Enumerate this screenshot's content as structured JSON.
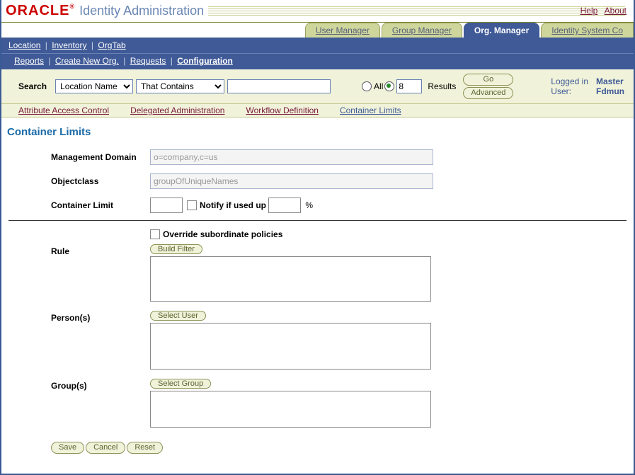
{
  "brand": {
    "name": "ORACLE",
    "product": "Identity Administration"
  },
  "top_links": {
    "help": "Help",
    "about": "About"
  },
  "tabs": {
    "user": "User Manager",
    "group": "Group Manager",
    "org": "Org. Manager",
    "sysconfig": "Identity System Co"
  },
  "nav": {
    "location": "Location",
    "inventory": "Inventory",
    "orgtab": "OrgTab"
  },
  "subnav": {
    "reports": "Reports",
    "create": "Create New Org.",
    "requests": "Requests",
    "configuration": "Configuration"
  },
  "search": {
    "label": "Search",
    "field_select": "Location Name",
    "op_select": "That Contains",
    "value": "",
    "all_label": "All",
    "count": "8",
    "results_label": "Results",
    "go": "Go",
    "advanced": "Advanced"
  },
  "logged": {
    "label1": "Logged in",
    "label2": "User:",
    "val1": "Master",
    "val2": "Fdmun"
  },
  "config_tabs": {
    "aac": "Attribute Access Control",
    "da": "Delegated Administration",
    "wf": "Workflow Definition",
    "cl": "Container Limits"
  },
  "page_title": "Container Limits",
  "form": {
    "mgmt_domain_label": "Management Domain",
    "mgmt_domain_value": "o=company,c=us",
    "objclass_label": "Objectclass",
    "objclass_value": "groupOfUniqueNames",
    "container_limit_label": "Container Limit",
    "container_limit_value": "",
    "notify_label": "Notify if used up",
    "notify_pct": "",
    "pct_sign": "%",
    "override_label": "Override subordinate policies",
    "rule_label": "Rule",
    "build_filter": "Build Filter",
    "persons_label": "Person(s)",
    "select_user": "Select User",
    "groups_label": "Group(s)",
    "select_group": "Select Group"
  },
  "buttons": {
    "save": "Save",
    "cancel": "Cancel",
    "reset": "Reset"
  }
}
